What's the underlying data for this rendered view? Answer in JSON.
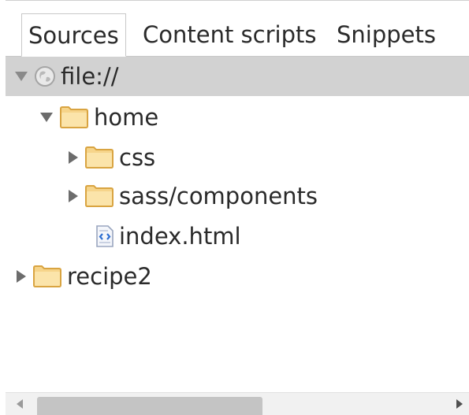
{
  "tabs": [
    {
      "label": "Sources",
      "active": true
    },
    {
      "label": "Content scripts",
      "active": false
    },
    {
      "label": "Snippets",
      "active": false
    }
  ],
  "tree": {
    "root": {
      "label": "file://",
      "icon": "globe-icon",
      "expanded": true,
      "selected": true
    },
    "home": {
      "label": "home",
      "icon": "folder-icon",
      "expanded": true
    },
    "css": {
      "label": "css",
      "icon": "folder-icon",
      "expanded": false
    },
    "sass": {
      "label": "sass/components",
      "icon": "folder-icon",
      "expanded": false
    },
    "index": {
      "label": "index.html",
      "icon": "html-file-icon"
    },
    "recipe2": {
      "label": "recipe2",
      "icon": "folder-icon",
      "expanded": false
    }
  },
  "colors": {
    "selected_row": "#d2d2d2",
    "folder_fill": "#f6d48a",
    "folder_edge": "#d9a441",
    "scroll_thumb": "#c4c4c4"
  }
}
